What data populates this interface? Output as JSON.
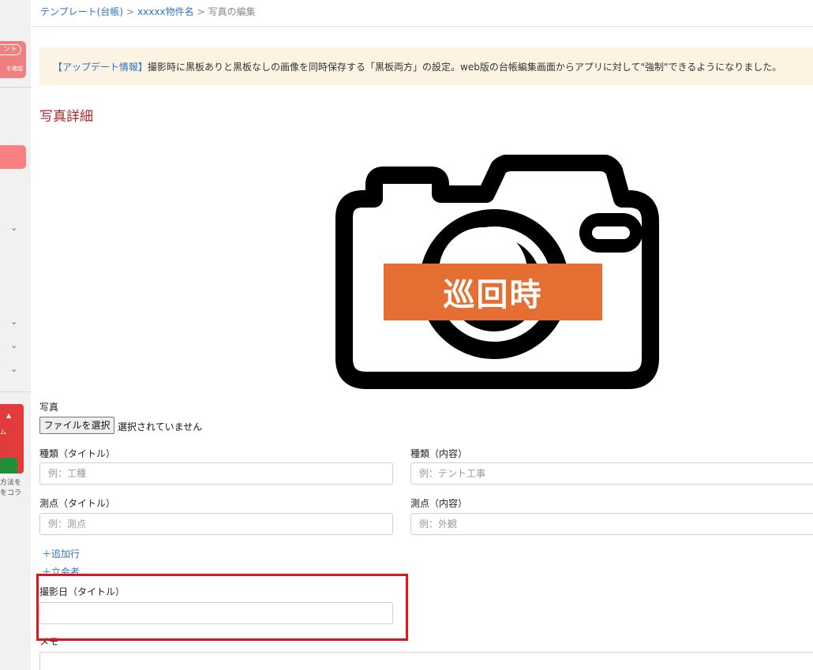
{
  "breadcrumb": {
    "items": [
      "テンプレート(台帳)",
      "xxxxx物件名",
      "写真の編集"
    ],
    "separator": ">"
  },
  "sidebar": {
    "pill_label": "ント",
    "pill_sub": "を確認",
    "banner_top": "▲",
    "banner_mid": "ム",
    "text_line1": "方法を",
    "text_line2": "をコラ"
  },
  "notice": {
    "tag": "【アップデート情報】",
    "text": "撮影時に黒板ありと黒板なしの画像を同時保存する「黒板両方」の設定。web版の台帳編集画面からアプリに対して\"強制\"できるようになりました。"
  },
  "page": {
    "title": "写真詳細"
  },
  "photo": {
    "band_label": "巡回時",
    "band_color": "#e56f33"
  },
  "form": {
    "photo_label": "写真",
    "file_button": "ファイルを選択",
    "file_status": "選択されていません",
    "type_title_label": "種類（タイトル）",
    "type_title_placeholder": "例：工種",
    "type_content_label": "種類（内容）",
    "type_content_placeholder": "例：テント工事",
    "point_title_label": "測点（タイトル）",
    "point_title_placeholder": "例：測点",
    "point_content_label": "測点（内容）",
    "point_content_placeholder": "例：外観",
    "add_row": "＋追加行",
    "add_witness": "＋立会者",
    "date_title_label": "撮影日（タイトル）",
    "date_title_value": "",
    "memo_label": "メモ"
  },
  "colors": {
    "accent_link": "#2f73c4",
    "title_red": "#b3262a",
    "highlight_red": "#e0141c",
    "notice_bg": "#fdf3e3"
  }
}
